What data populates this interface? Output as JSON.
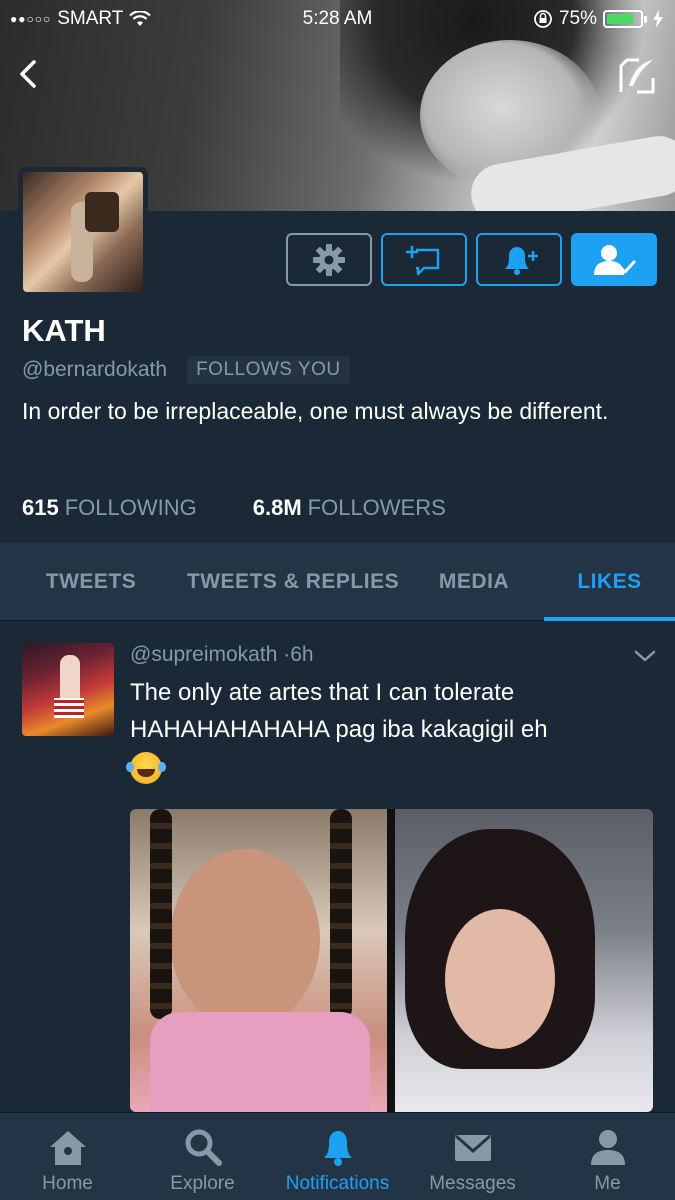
{
  "status_bar": {
    "signal_dots": "●●○○○",
    "carrier": "SMART",
    "time": "5:28 AM",
    "battery_percent": "75%",
    "battery_level": 0.75
  },
  "profile": {
    "name": "KATH",
    "handle": "@bernardokath",
    "follows_you": "FOLLOWS YOU",
    "bio": "In order to be irreplaceable, one must always be different.",
    "following_count": "615",
    "following_label": "FOLLOWING",
    "followers_count": "6.8M",
    "followers_label": "FOLLOWERS"
  },
  "tabs": [
    {
      "label": "TWEETS"
    },
    {
      "label": "TWEETS & REPLIES"
    },
    {
      "label": "MEDIA"
    },
    {
      "label": "LIKES",
      "active": true
    }
  ],
  "tweet": {
    "handle": "@supreimokath",
    "separator": "·",
    "time": "6h",
    "text": "The only ate artes that I can tolerate HAHAHAHAHAHA pag iba kakagigil eh"
  },
  "bottom_nav": [
    {
      "label": "Home",
      "icon": "home-icon"
    },
    {
      "label": "Explore",
      "icon": "search-icon"
    },
    {
      "label": "Notifications",
      "icon": "bell-icon",
      "active": true
    },
    {
      "label": "Messages",
      "icon": "envelope-icon"
    },
    {
      "label": "Me",
      "icon": "person-icon"
    }
  ],
  "colors": {
    "background": "#1b2836",
    "accent": "#1da1f2",
    "muted": "#8899a6",
    "bar": "#243447"
  }
}
